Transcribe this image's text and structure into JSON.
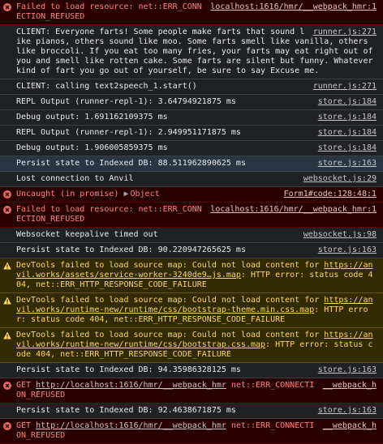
{
  "entries": [
    {
      "level": "error",
      "icon": "error-icon",
      "text": "Failed to load resource: net::ERR_CONNECTION_REFUSED",
      "source": "localhost:1616/hmr/__webpack_hmr:1"
    },
    {
      "level": "log",
      "text": "CLIENT: Everyone farts! Some people make farts that sound like pianos, others sound like moo. Some farts smell like vanilla, others like broccoli. If you eat too many fries, your farts may eat right out of you and smell like rotten cake.  Some farts are silent but funny.  Whatever kind of fart you go out of yourself, be sure to say Excuse me.",
      "source": "runner.js:271"
    },
    {
      "level": "log",
      "text": "CLIENT: calling text2speech_1.start()",
      "source": "runner.js:271"
    },
    {
      "level": "log",
      "text": "REPL Output (runner-repl-1): 3.64794921875 ms",
      "source": "store.js:184"
    },
    {
      "level": "log",
      "text": "Debug output: 1.691162109375 ms",
      "source": "store.js:184"
    },
    {
      "level": "log",
      "text": "REPL Output (runner-repl-1): 2.949951171875 ms",
      "source": "store.js:184"
    },
    {
      "level": "log",
      "text": "Debug output: 1.906005859375 ms",
      "source": "store.js:184"
    },
    {
      "level": "log",
      "highlight": true,
      "text": "Persist state to Indexed DB: 88.511962890625 ms",
      "source": "store.js:163"
    },
    {
      "level": "log",
      "text": "Lost connection to Anvil",
      "source": "websocket.js:29"
    },
    {
      "level": "error",
      "icon": "error-icon",
      "object": true,
      "text": "Uncaught (in promise)",
      "object_label": "Object",
      "source": "Form1#code:128:48:1"
    },
    {
      "level": "error",
      "icon": "error-icon",
      "text": "Failed to load resource: net::ERR_CONNECTION_REFUSED",
      "source": "localhost:1616/hmr/__webpack_hmr:1"
    },
    {
      "level": "log",
      "text": "Websocket keepalive timed out",
      "source": "websocket.js:98"
    },
    {
      "level": "log",
      "text": "Persist state to Indexed DB: 90.220947265625 ms",
      "source": "store.js:163"
    },
    {
      "level": "warn",
      "icon": "warning-icon",
      "text_before": "DevTools failed to load source map: Could not load content for ",
      "link": "https://anvil.works/assets/service-worker-3240de9…js.map",
      "text_after": ": HTTP error: status code 404, net::ERR_HTTP_RESPONSE_CODE_FAILURE"
    },
    {
      "level": "warn",
      "icon": "warning-icon",
      "text_before": "DevTools failed to load source map: Could not load content for ",
      "link": "https://anvil.works/runtime-new/runtime/css/bootstrap-theme.min.css.map",
      "text_after": ": HTTP error: status code 404, net::ERR_HTTP_RESPONSE_CODE_FAILURE"
    },
    {
      "level": "warn",
      "icon": "warning-icon",
      "text_before": "DevTools failed to load source map: Could not load content for ",
      "link": "https://anvil.works/runtime-new/runtime/css/bootstrap.css.map",
      "text_after": ": HTTP error: status code 404, net::ERR_HTTP_RESPONSE_CODE_FAILURE"
    },
    {
      "level": "log",
      "text": "Persist state to Indexed DB: 94.35986328125 ms",
      "source": "store.js:163"
    },
    {
      "level": "error",
      "icon": "error-icon",
      "text_before": "GET ",
      "link": "http://localhost:1616/hmr/__webpack_hmr",
      "text_after": " net::ERR_CONNECTION_REFUSED",
      "source": "__webpack_h"
    },
    {
      "level": "log",
      "text": "Persist state to Indexed DB: 92.4638671875 ms",
      "source": "store.js:163"
    },
    {
      "level": "error",
      "icon": "error-icon",
      "text_before": "GET ",
      "link": "http://localhost:1616/hmr/__webpack_hmr",
      "text_after": " net::ERR_CONNECTION_REFUSED",
      "source": "__webpack_h"
    }
  ]
}
